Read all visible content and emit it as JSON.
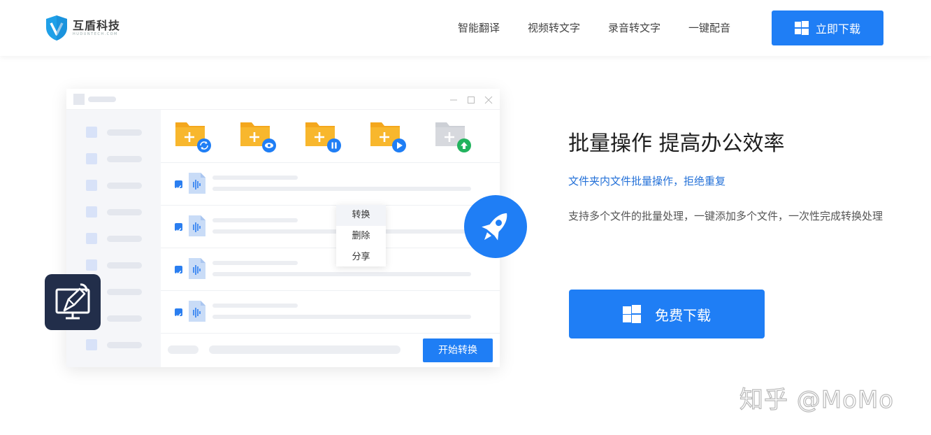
{
  "header": {
    "logo_cn": "互盾科技",
    "logo_en": "HUDUNTECH.COM",
    "nav": [
      "智能翻译",
      "视频转文字",
      "录音转文字",
      "一键配音"
    ],
    "download_label": "立即下载"
  },
  "app": {
    "context_menu": [
      "转换",
      "删除",
      "分享"
    ],
    "start_label": "开始转换",
    "list_rows": 4,
    "sidebar_rows": 9
  },
  "feature": {
    "headline": "批量操作 提高办公效率",
    "subtitle": "文件夹内文件批量操作，拒绝重复",
    "description": "支持多个文件的批量处理，一键添加多个文件，一次性完成转换处理",
    "download_label": "免费下载"
  },
  "watermark": "知乎 @MoMo",
  "colors": {
    "accent": "#1f7ef5",
    "folder": "#f8b72d",
    "folder_disabled": "#d7d9de",
    "badge_bg": "#222e4a"
  },
  "icons": [
    "shield-logo-icon",
    "windows-icon",
    "refresh-icon",
    "eye-icon",
    "pause-icon",
    "play-icon",
    "upload-icon",
    "audio-file-icon",
    "checkbox-icon",
    "rocket-icon",
    "monitor-pen-icon"
  ]
}
